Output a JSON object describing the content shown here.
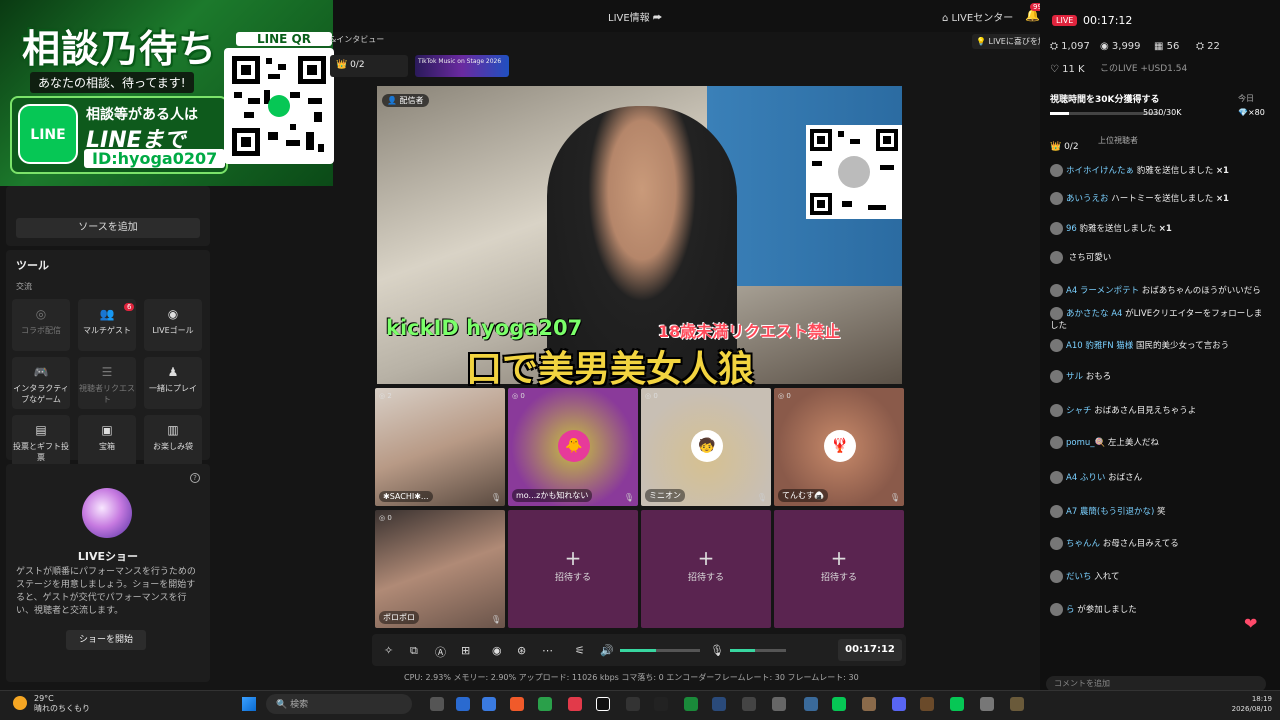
{
  "topbar": {
    "live_info": "LIVE情報 ⮫",
    "live_center": "⌂ LIVEセンター",
    "notif_count": "99+"
  },
  "promo": {
    "title": "相談乃待ち",
    "subtitle": "あなたの相談、待ってます!",
    "line_logo": "LINE",
    "line1": "相談等がある人は",
    "line2": "LINEまで",
    "id": "ID:hyoga0207",
    "qr_label": "LINE QR"
  },
  "left_panel": {
    "add_source": "ソースを追加",
    "tools_title": "ツール",
    "tools_sub": "交流",
    "tools": [
      {
        "label": "コラボ配信",
        "icon": "◎"
      },
      {
        "label": "マルチゲスト",
        "icon": "👥"
      },
      {
        "label": "LIVEゴール",
        "icon": "◉"
      },
      {
        "label": "インタラクティブなゲーム",
        "icon": "🎮"
      },
      {
        "label": "視聴者リクエスト",
        "icon": "☰"
      },
      {
        "label": "一緒にプレイ",
        "icon": "♟"
      },
      {
        "label": "投票とギフト投票",
        "icon": "▤"
      },
      {
        "label": "宝箱",
        "icon": "▣"
      },
      {
        "label": "お楽しみ袋",
        "icon": "▥"
      }
    ],
    "tool_badge": "6",
    "show_title": "LIVEショー",
    "show_desc": "ゲストが順番にパフォーマンスを行うためのステージを用意しましょう。ショーを開始すると、ゲストが交代でパフォーマンスを行い、視聴者と交流します。",
    "show_button": "ショーを開始",
    "show_help": "?"
  },
  "center": {
    "interview": "&インタビュー",
    "counter": "👑 0/2",
    "banner": "TikTok Music on Stage 2026",
    "hint": "💡 LIVEに喜びを加える",
    "host_tag": "👤 配信者",
    "kick": "kickID hyoga207",
    "under18": "18歳未満リクエスト禁止",
    "bigtext": "口で美男美女人狼",
    "tiles": [
      {
        "name": "✱SACHI✱...",
        "score": "◎ 2"
      },
      {
        "name": "mo...zかも知れない",
        "score": "◎ 0"
      },
      {
        "name": "ミニオン",
        "score": "◎ 0"
      },
      {
        "name": "てんむす🍙",
        "score": "◎ 0"
      },
      {
        "name": "ポロポロ",
        "score": "◎ 0"
      }
    ],
    "invite_plus": "+",
    "invite_label": "招待する",
    "timer": "00:17:12",
    "volume_level": 0.45,
    "mic_level": 0.45,
    "stats": "CPU: 2.93%   メモリー: 2.90%   アップロード: 11026 kbps   コマ落ち: 0   エンコーダーフレームレート: 30   フレームレート: 30"
  },
  "right_panel": {
    "live_badge": "LIVE",
    "time": "00:17:12",
    "stats": [
      "⛭ 1,097",
      "◉ 3,999",
      "▦ 56",
      "⛭ 22"
    ],
    "hearts": "♡ 11 K",
    "usd": "このLIVE +USD1.54",
    "goal_title": "視聴時間を30K分獲得する",
    "goal_today": "今日",
    "goal_value": "5030/30K",
    "goal_progress": 0.17,
    "goal_gift": "💎×80",
    "top_viewers": "上位視聴者",
    "counter": "👑 0/2",
    "messages": [
      {
        "user": "ホイホイけんたぁ",
        "text": "豹雅を送信しました",
        "extra": "×1"
      },
      {
        "user": "あいうえお",
        "text": "ハートミーを送信しました",
        "extra": "×1"
      },
      {
        "user": "96",
        "text": "豹雅を送信しました",
        "extra": "×1"
      },
      {
        "user": "",
        "text": "さち可愛い",
        "extra": ""
      },
      {
        "user": "A4 ラーメンポテト",
        "text": "おばあちゃんのほうがいいだら",
        "extra": ""
      },
      {
        "user": "あかさたな A4",
        "text": "がLIVEクリエイターをフォローしました",
        "extra": ""
      },
      {
        "user": "A10 豹雅FN 猫様",
        "text": "国民的美少女って言おう",
        "extra": ""
      },
      {
        "user": "サル",
        "text": "おもろ",
        "extra": ""
      },
      {
        "user": "シャチ",
        "text": "おばあさん目見えちゃうよ",
        "extra": ""
      },
      {
        "user": "pomu_🍭",
        "text": "左上美人だね",
        "extra": ""
      },
      {
        "user": "A4 ふりい",
        "text": "おばさん",
        "extra": ""
      },
      {
        "user": "A7 農簡(もう引退かな)",
        "text": "笑",
        "extra": ""
      },
      {
        "user": "ちゃんん",
        "text": "お母さん目みえてる",
        "extra": ""
      },
      {
        "user": "だいち",
        "text": "入れて",
        "extra": ""
      },
      {
        "user": "ら",
        "text": "が参加しました",
        "extra": ""
      }
    ],
    "comment_placeholder": "コメントを追加"
  },
  "taskbar": {
    "weather_temp": "29°C",
    "weather_desc": "晴れのちくもり",
    "search": "検索",
    "clock_time": "18:19",
    "clock_date": "2026/08/10"
  }
}
